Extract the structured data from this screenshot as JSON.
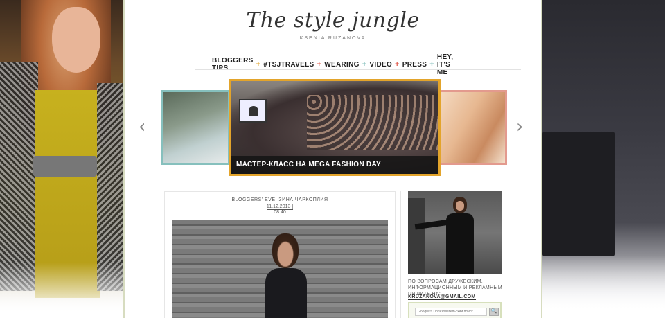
{
  "header": {
    "logo": "The style jungle",
    "tagline": "KSENIA RUZANOVA"
  },
  "nav": {
    "items": [
      {
        "label": "BLOGGERS TIPS"
      },
      {
        "label": "#TSJTRAVELS"
      },
      {
        "label": "WEARING"
      },
      {
        "label": "VIDEO"
      },
      {
        "label": "PRESS"
      },
      {
        "label": "HEY, IT'S ME"
      }
    ],
    "separators": [
      {
        "symbol": "+",
        "color": "#e3a42b"
      },
      {
        "symbol": "+",
        "color": "#e0584a"
      },
      {
        "symbol": "+",
        "color": "#86c0bd"
      },
      {
        "symbol": "+",
        "color": "#e0584a"
      },
      {
        "symbol": "+",
        "color": "#86c0bd"
      }
    ]
  },
  "slider": {
    "caption": "МАСТЕР-КЛАСС НА MEGA FASHION DAY",
    "prev_icon": "‹",
    "next_icon": "›",
    "border_colors": {
      "left": "#86c0bd",
      "center": "#e3a42b",
      "right": "#e39a8e"
    }
  },
  "post": {
    "title": "BLOGGERS' EVE: ЗИНА ЧАРКОПЛИЯ",
    "date": "11.12.2013 |",
    "time": "08:40"
  },
  "sidebar": {
    "contact_text": "ПО ВОПРОСАМ ДРУЖЕСКИМ, ИНФОРМАЦИОННЫМ И РЕКЛАМНЫМ ПИШИТЕ НА:",
    "email": "KRUZANOVA@GMAIL.COM",
    "search_placeholder": "Google™ Пользовательский поиск",
    "search_button": "🔍"
  }
}
